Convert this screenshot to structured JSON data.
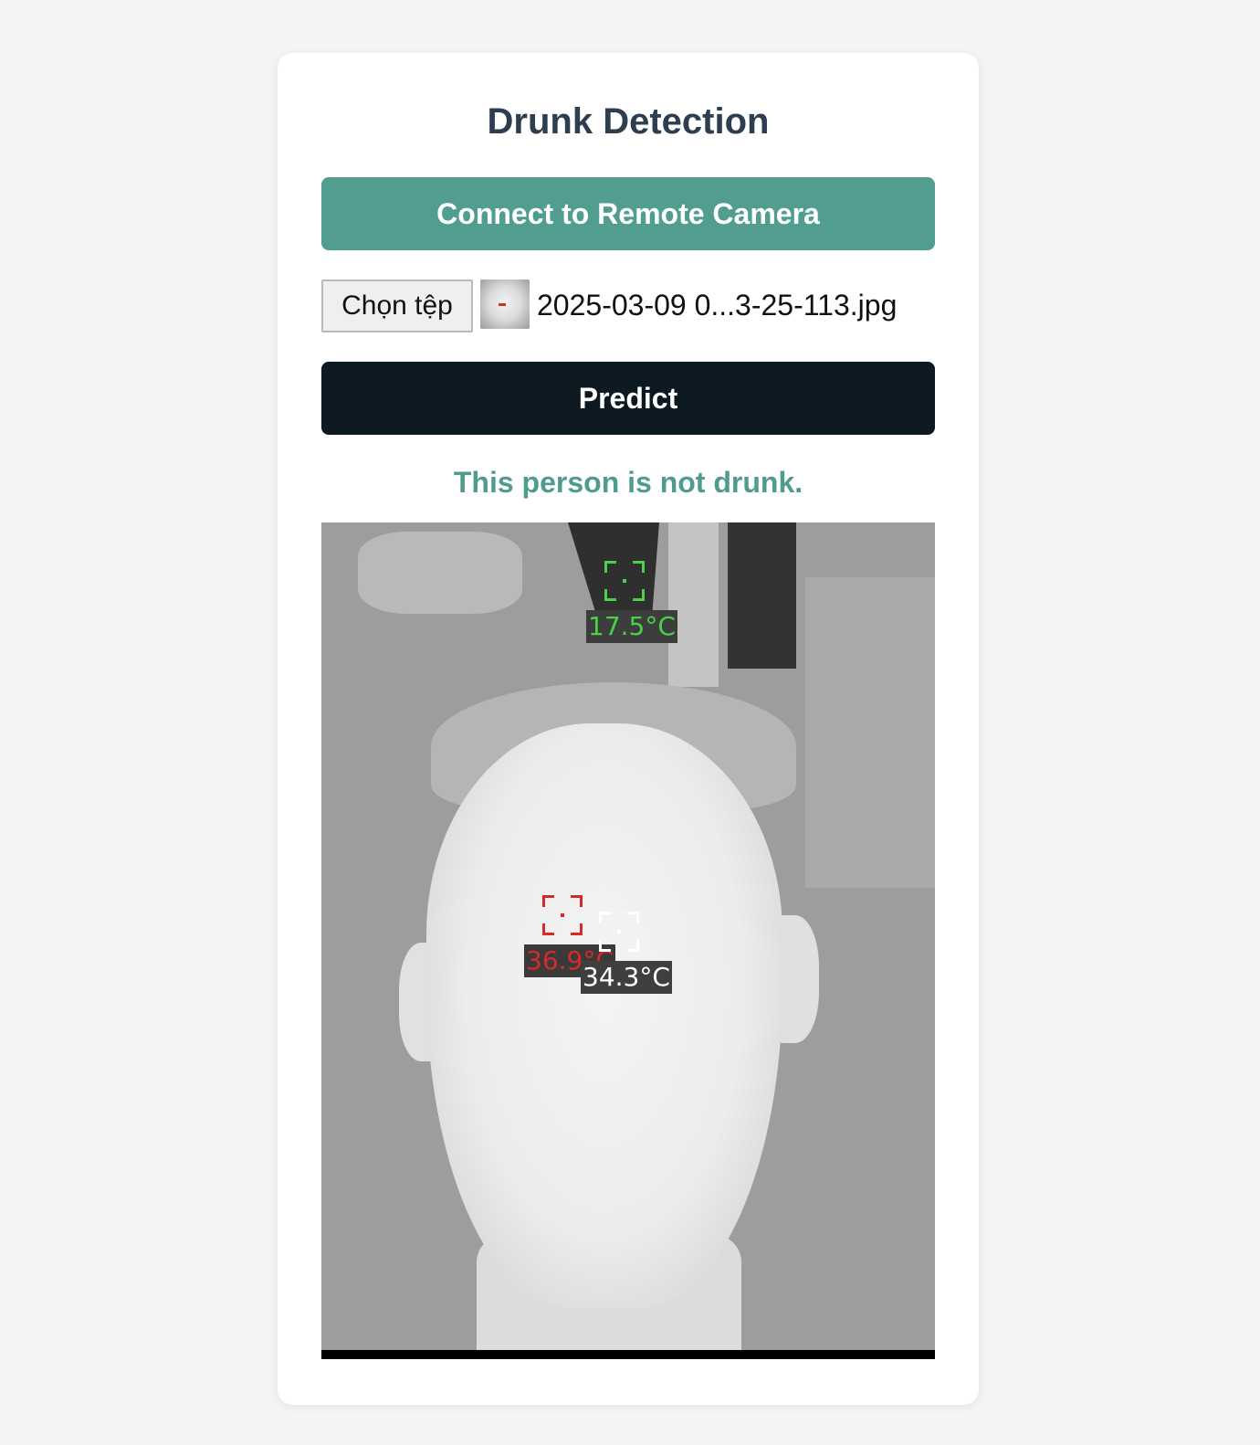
{
  "header": {
    "title": "Drunk Detection"
  },
  "actions": {
    "connect_label": "Connect to Remote Camera",
    "predict_label": "Predict"
  },
  "file_input": {
    "button_label": "Chọn tệp",
    "file_name": "2025-03-09 0...3-25-113.jpg"
  },
  "result": {
    "message": "This person is not drunk.",
    "color": "#4f9c8e"
  },
  "thermal_image": {
    "readings": [
      {
        "name": "background-marker",
        "temperature": "17.5°C",
        "color": "#49d147"
      },
      {
        "name": "max-marker",
        "temperature": "36.9°C",
        "color": "#d62a2a"
      },
      {
        "name": "center-marker",
        "temperature": "34.3°C",
        "color": "#ffffff"
      }
    ]
  },
  "colors": {
    "page_background": "#f3f4f6",
    "connect_button": "#519d8f",
    "predict_button": "#0c1920",
    "title_text": "#2c3e50"
  }
}
